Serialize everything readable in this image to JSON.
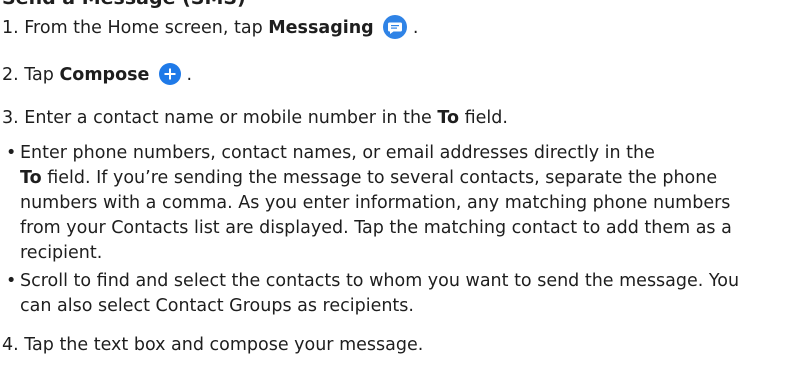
{
  "heading_partial": "Send a Message (SMS)",
  "steps": [
    {
      "prefix": "1. From the Home screen, tap ",
      "bold": "Messaging",
      "suffix": " .",
      "icon": "messaging-bubble-icon"
    },
    {
      "prefix": "2. Tap ",
      "bold": "Compose",
      "suffix": " .",
      "icon": "compose-plus-icon"
    },
    {
      "prefix": "3. Enter a contact name or mobile number in the ",
      "bold": "To",
      "suffix": " field."
    },
    {
      "text": "4. Tap the text box and compose your message."
    }
  ],
  "bullets": [
    {
      "bullet": "•",
      "prefix": "Enter phone numbers, contact names, or email addresses directly in the",
      "bold": "To",
      "suffix": " field. If you’re sending the message to several contacts, separate the phone numbers with a comma. As you enter information, any matching phone numbers from your Contacts list are displayed. Tap the matching contact to add them as a recipient."
    },
    {
      "bullet": "•",
      "text": "Scroll to find and select the contacts to whom you want to send the message. You can also select Contact Groups as recipients."
    }
  ],
  "colors": {
    "text": "#1e1e1e",
    "icon_blue": "#2f83e6"
  }
}
